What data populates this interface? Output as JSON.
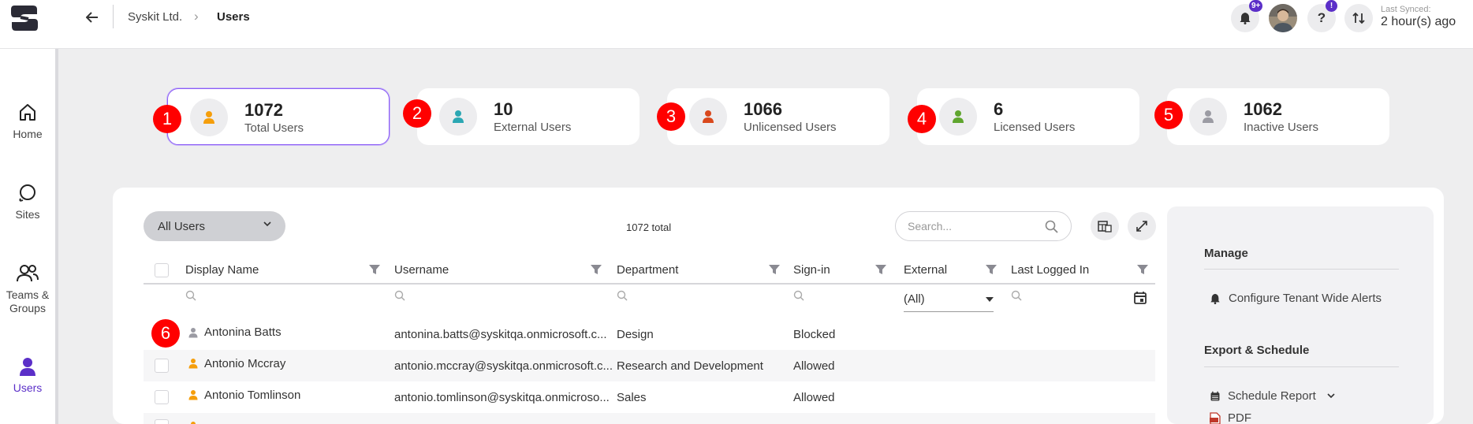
{
  "breadcrumb": {
    "org": "Syskit Ltd.",
    "separator": "›",
    "page": "Users"
  },
  "topbar": {
    "notifications_badge": "9+",
    "help_badge": "!",
    "last_synced_label": "Last Synced:",
    "last_synced_value": "2 hour(s) ago"
  },
  "sidebar": {
    "items": [
      {
        "label": "Home",
        "icon": "home-icon"
      },
      {
        "label": "Sites",
        "icon": "sites-icon"
      },
      {
        "label": "Teams &\nGroups",
        "icon": "teams-icon"
      },
      {
        "label": "Users",
        "icon": "user-icon",
        "active": true
      }
    ]
  },
  "stats": [
    {
      "value": "1072",
      "label": "Total Users",
      "icon_color": "#f59e0b",
      "marker": "1"
    },
    {
      "value": "10",
      "label": "External Users",
      "icon_color": "#2ba7b3",
      "marker": "2"
    },
    {
      "value": "1066",
      "label": "Unlicensed Users",
      "icon_color": "#d9481c",
      "marker": "3"
    },
    {
      "value": "6",
      "label": "Licensed Users",
      "icon_color": "#5fa52e",
      "marker": "4"
    },
    {
      "value": "1062",
      "label": "Inactive Users",
      "icon_color": "#9b9ba3",
      "marker": "5"
    }
  ],
  "toolbar": {
    "filter_select": "All Users",
    "total_label": "1072 total",
    "search_placeholder": "Search..."
  },
  "grid": {
    "columns": [
      "Display Name",
      "Username",
      "Department",
      "Sign-in",
      "External",
      "Last Logged In"
    ],
    "external_filter": "(All)",
    "row_marker": "6",
    "rows": [
      {
        "name": "Antonina Batts",
        "username": "antonina.batts@syskitqa.onmicrosoft.c...",
        "department": "Design",
        "signin": "Blocked",
        "icon_color": "#9b9ba3"
      },
      {
        "name": "Antonio Mccray",
        "username": "antonio.mccray@syskitqa.onmicrosoft.c...",
        "department": "Research and Development",
        "signin": "Allowed",
        "icon_color": "#f59e0b"
      },
      {
        "name": "Antonio Tomlinson",
        "username": "antonio.tomlinson@syskitqa.onmicroso...",
        "department": "Sales",
        "signin": "Allowed",
        "icon_color": "#f59e0b"
      }
    ]
  },
  "right_panel": {
    "manage_heading": "Manage",
    "configure_alerts": "Configure Tenant Wide Alerts",
    "export_heading": "Export & Schedule",
    "schedule_report": "Schedule Report",
    "pdf": "PDF"
  },
  "colors": {
    "accent": "#5b2fc8",
    "marker": "#ff0000",
    "selected_border": "#8b5cf6"
  }
}
